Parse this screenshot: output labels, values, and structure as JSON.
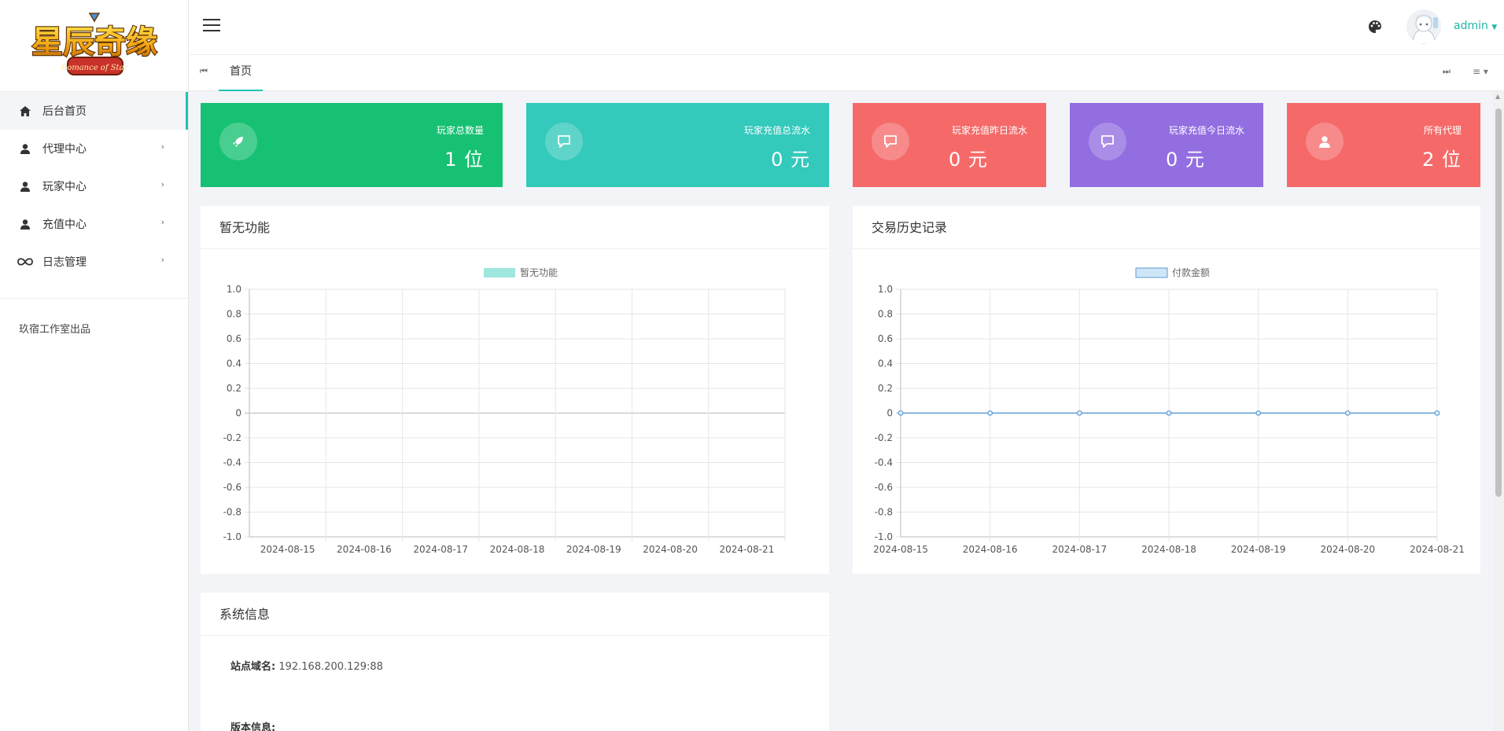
{
  "brand": {
    "logo_text": "星辰奇缘",
    "logo_subtext": "Romance of Star"
  },
  "sidebar": {
    "items": [
      {
        "label": "后台首页",
        "icon": "home-icon",
        "active": true,
        "has_children": false
      },
      {
        "label": "代理中心",
        "icon": "user-icon",
        "active": false,
        "has_children": true
      },
      {
        "label": "玩家中心",
        "icon": "user-icon",
        "active": false,
        "has_children": true
      },
      {
        "label": "充值中心",
        "icon": "user-icon",
        "active": false,
        "has_children": true
      },
      {
        "label": "日志管理",
        "icon": "infinity-icon",
        "active": false,
        "has_children": true
      }
    ],
    "credit": "玖宿工作室出品"
  },
  "topbar": {
    "user": "admin"
  },
  "tabs": {
    "home": "首页"
  },
  "stats": [
    {
      "title": "玩家总数量",
      "value": "1 位",
      "color": "#17c173",
      "icon": "rocket-icon"
    },
    {
      "title": "玩家充值总流水",
      "value": "0 元",
      "color": "#33c9bb",
      "icon": "comment-icon"
    },
    {
      "title": "玩家充值昨日流水",
      "value": "0 元",
      "color": "#f56a69",
      "icon": "comment-icon"
    },
    {
      "title": "玩家充值今日流水",
      "value": "0 元",
      "color": "#936ee0",
      "icon": "comment-icon"
    },
    {
      "title": "所有代理",
      "value": "2 位",
      "color": "#f56a69",
      "icon": "user-icon"
    }
  ],
  "panels": {
    "left_chart_title": "暂无功能",
    "right_chart_title": "交易历史记录",
    "sysinfo_title": "系统信息"
  },
  "sysinfo": {
    "domain_label": "站点域名:",
    "domain_value": "192.168.200.129:88",
    "version_label": "版本信息:"
  },
  "chart_data": [
    {
      "type": "bar",
      "legend": "暂无功能",
      "legend_color": "#9fe6de",
      "categories": [
        "2024-08-15",
        "2024-08-16",
        "2024-08-17",
        "2024-08-18",
        "2024-08-19",
        "2024-08-20",
        "2024-08-21"
      ],
      "values": [
        0,
        0,
        0,
        0,
        0,
        0,
        0
      ],
      "ylim": [
        -1.0,
        1.0
      ],
      "yticks": [
        "1.0",
        "0.8",
        "0.6",
        "0.4",
        "0.2",
        "0",
        "-0.2",
        "-0.4",
        "-0.6",
        "-0.8",
        "-1.0"
      ],
      "grid": true,
      "legend_position": "top-center"
    },
    {
      "type": "line",
      "legend": "付款金额",
      "legend_color": "#cfe6f6",
      "line_color": "#5b9bd5",
      "categories": [
        "2024-08-15",
        "2024-08-16",
        "2024-08-17",
        "2024-08-18",
        "2024-08-19",
        "2024-08-20",
        "2024-08-21"
      ],
      "values": [
        0,
        0,
        0,
        0,
        0,
        0,
        0
      ],
      "ylim": [
        -1.0,
        1.0
      ],
      "yticks": [
        "1.0",
        "0.8",
        "0.6",
        "0.4",
        "0.2",
        "0",
        "-0.2",
        "-0.4",
        "-0.6",
        "-0.8",
        "-1.0"
      ],
      "grid": true,
      "legend_position": "top-center"
    }
  ]
}
